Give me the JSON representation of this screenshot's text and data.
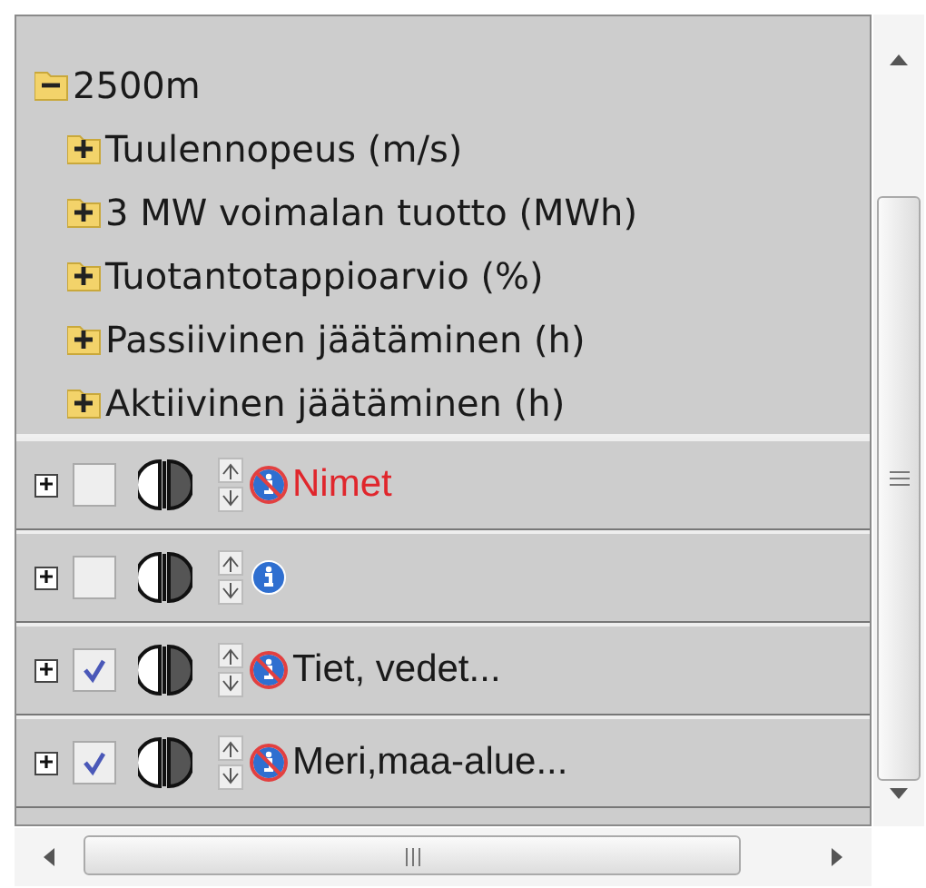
{
  "tree": [
    {
      "label": "2500m",
      "expanded": true,
      "children": [
        {
          "label": "Tuulennopeus (m/s)",
          "expanded": false
        },
        {
          "label": "3 MW voimalan tuotto (MWh)",
          "expanded": false
        },
        {
          "label": "Tuotantotappioarvio (%)",
          "expanded": false
        },
        {
          "label": "Passiivinen jäätäminen (h)",
          "expanded": false
        },
        {
          "label": "Aktiivinen jäätäminen (h)",
          "expanded": false
        }
      ]
    }
  ],
  "layers": [
    {
      "label": "Nimet",
      "checked": false,
      "info_crossed": true,
      "color": "#e0262c"
    },
    {
      "checked": false,
      "info_crossed": false
    },
    {
      "label": "Tiet, vedet...",
      "checked": true,
      "info_crossed": true,
      "color": "#1a1a1a"
    },
    {
      "label": "Meri,maa-alue...",
      "checked": true,
      "info_crossed": true,
      "color": "#1a1a1a"
    }
  ]
}
